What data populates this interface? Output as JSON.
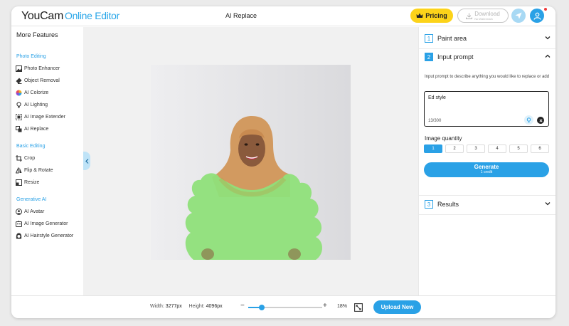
{
  "header": {
    "brand": "YouCam",
    "brand_sub": "Online Editor",
    "title": "AI Replace",
    "pricing_label": "Pricing",
    "download_label": "Download",
    "download_sub": "No Watermark"
  },
  "sidebar": {
    "title": "More Features",
    "sections": [
      {
        "label": "Photo Editing"
      },
      {
        "label": "Basic Editing"
      },
      {
        "label": "Generative AI"
      }
    ],
    "items": [
      {
        "label": "Photo Enhancer",
        "icon": "image-icon"
      },
      {
        "label": "Object Removal",
        "icon": "eraser-icon"
      },
      {
        "label": "AI Colorize",
        "icon": "color-wheel-icon"
      },
      {
        "label": "AI Lighting",
        "icon": "bulb-icon"
      },
      {
        "label": "AI Image Extender",
        "icon": "expand-icon"
      },
      {
        "label": "AI Replace",
        "icon": "replace-icon"
      },
      {
        "label": "Crop",
        "icon": "crop-icon"
      },
      {
        "label": "Flip & Rotate",
        "icon": "flip-icon"
      },
      {
        "label": "Resize",
        "icon": "resize-icon"
      },
      {
        "label": "AI Avatar",
        "icon": "avatar-icon"
      },
      {
        "label": "AI Image Generator",
        "icon": "generator-icon"
      },
      {
        "label": "AI Hairstyle Generator",
        "icon": "hairstyle-icon"
      }
    ]
  },
  "right_panel": {
    "sections": [
      {
        "num": "1",
        "label": "Paint area"
      },
      {
        "num": "2",
        "label": "Input prompt"
      },
      {
        "num": "3",
        "label": "Results"
      }
    ],
    "hint": "Input prompt to describe anything you would like to replace or add",
    "prompt_value": "Ed style",
    "prompt_count": "13/300",
    "quantity_label": "Image quantity",
    "quantities": [
      "1",
      "2",
      "3",
      "4",
      "5",
      "6"
    ],
    "quantity_selected": "1",
    "generate_label": "Generate",
    "generate_sub": "1 credit"
  },
  "bottom": {
    "width_label": "Width:",
    "width_value": "3277px",
    "height_label": "Height:",
    "height_value": "4096px",
    "minus": "−",
    "plus": "+",
    "zoom": "18%",
    "zoom_fraction": 0.18,
    "upload_label": "Upload New"
  },
  "colors": {
    "accent": "#2aa1e6",
    "pricing": "#fcd31a",
    "mask": "#8fe07a"
  }
}
